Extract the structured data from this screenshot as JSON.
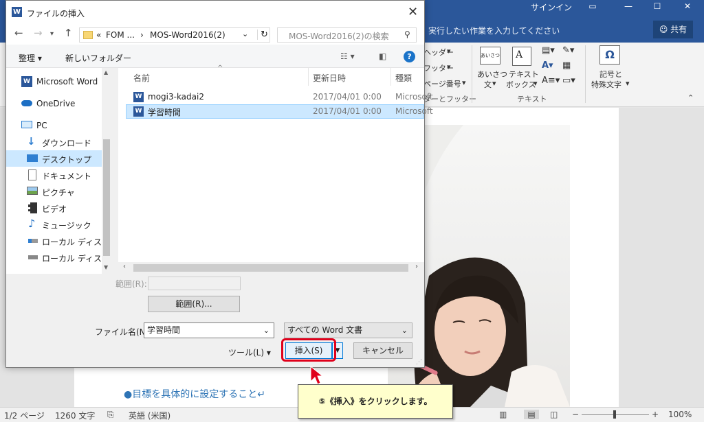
{
  "word": {
    "signin": "サインイン",
    "tellme": "実行したい作業を入力してください",
    "share": "共有",
    "ribbon": {
      "header_partial": "ヘッダー",
      "footer_partial": "フッター",
      "page_number_partial": "ページ番号",
      "group_header_footer_partial": "ダーとフッター",
      "greeting_line1": "あいさつ",
      "greeting_line2": "文",
      "greeting_icon_text": "あいさつ",
      "textbox_line1": "テキスト",
      "textbox_line2": "ボックス",
      "group_text": "テキスト",
      "symbol_line1": "記号と",
      "symbol_line2": "特殊文字",
      "symbol_glyph": "Ω"
    },
    "doc_bullet": "●目標を具体的に設定すること↵",
    "status": {
      "page": "1/2 ページ",
      "words": "1260 文字",
      "language": "英語 (米国)",
      "zoom": "100%"
    }
  },
  "dialog": {
    "title": "ファイルの挿入",
    "address": {
      "prefix": "«",
      "crumb1": "FOM ...",
      "sep": "›",
      "crumb2": "MOS-Word2016(2)"
    },
    "search_placeholder": "MOS-Word2016(2)の検索",
    "toolbar": {
      "organize": "整理 ▾",
      "new_folder": "新しいフォルダー"
    },
    "nav_items": [
      {
        "label": "Microsoft Word"
      },
      {
        "label": "OneDrive"
      },
      {
        "label": "PC"
      },
      {
        "label": "ダウンロード"
      },
      {
        "label": "デスクトップ"
      },
      {
        "label": "ドキュメント"
      },
      {
        "label": "ピクチャ"
      },
      {
        "label": "ビデオ"
      },
      {
        "label": "ミュージック"
      },
      {
        "label": "ローカル ディスク (C"
      },
      {
        "label": "ローカル ディスク (D"
      }
    ],
    "columns": {
      "name": "名前",
      "date": "更新日時",
      "type": "種類"
    },
    "files": [
      {
        "name": "mogi3-kadai2",
        "date": "2017/04/01 0:00",
        "type": "Microsoft"
      },
      {
        "name": "学習時間",
        "date": "2017/04/01 0:00",
        "type": "Microsoft"
      }
    ],
    "range_label": "範囲(R):",
    "range_button": "範囲(R)...",
    "filename_label": "ファイル名(N):",
    "filename_value": "学習時間",
    "filetype_value": "すべての Word 文書",
    "tools_label": "ツール(L)",
    "insert_button": "挿入(S)",
    "cancel_button": "キャンセル"
  },
  "callout": {
    "text": "⑤《挿入》をクリックします。"
  },
  "colors": {
    "word_blue": "#2b579a",
    "highlight_red": "#e0001b",
    "selected_row": "#cce8ff",
    "callout_bg": "#ffffcc"
  }
}
